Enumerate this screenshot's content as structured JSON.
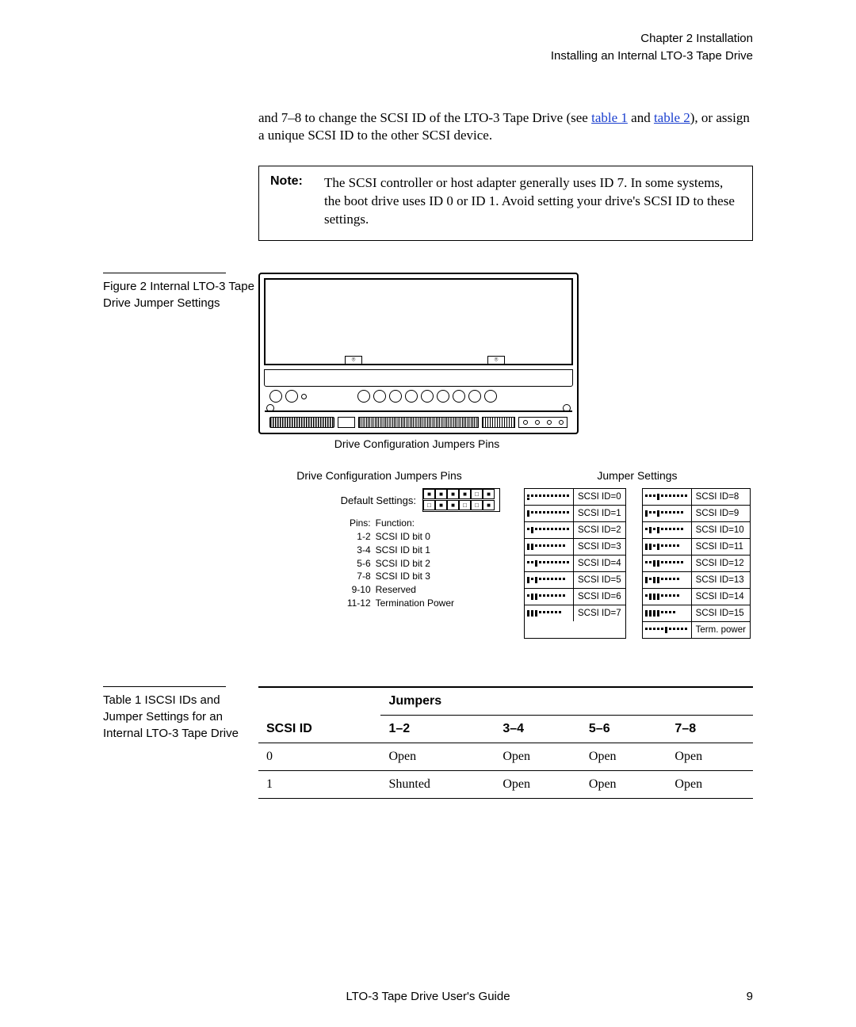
{
  "header": {
    "chapter": "Chapter 2  Installation",
    "section": "Installing an Internal LTO-3 Tape Drive"
  },
  "body": {
    "p1_a": "and 7–8 to change the SCSI ID of the LTO-3 Tape Drive (see ",
    "link1": "table 1",
    "p1_b": " and ",
    "link2": "table 2",
    "p1_c": "), or assign a unique SCSI ID to the other SCSI device."
  },
  "note": {
    "label": "Note:",
    "text": "The SCSI controller or host adapter generally uses ID 7. In some systems, the boot drive uses ID 0 or ID 1. Avoid setting your drive's SCSI ID to these settings."
  },
  "figure": {
    "caption": "Figure 2  Internal LTO-3 Tape Drive Jumper Settings",
    "callout": "Drive Configuration Jumpers Pins",
    "left_title": "Drive Configuration Jumpers Pins",
    "right_title": "Jumper Settings",
    "default_label": "Default Settings:",
    "pins_hdr": "Pins:",
    "func_hdr": "Function:",
    "pin_rows": [
      {
        "p": "1-2",
        "f": "SCSI ID bit 0"
      },
      {
        "p": "3-4",
        "f": "SCSI ID bit 1"
      },
      {
        "p": "5-6",
        "f": "SCSI ID bit 2"
      },
      {
        "p": "7-8",
        "f": "SCSI ID bit 3"
      },
      {
        "p": "9-10",
        "f": "Reserved"
      },
      {
        "p": "11-12",
        "f": "Termination Power"
      }
    ],
    "js_left": [
      "SCSI ID=0",
      "SCSI ID=1",
      "SCSI ID=2",
      "SCSI ID=3",
      "SCSI ID=4",
      "SCSI ID=5",
      "SCSI ID=6",
      "SCSI ID=7"
    ],
    "js_right": [
      "SCSI ID=8",
      "SCSI ID=9",
      "SCSI ID=10",
      "SCSI ID=11",
      "SCSI ID=12",
      "SCSI ID=13",
      "SCSI ID=14",
      "SCSI ID=15",
      "Term. power"
    ]
  },
  "table": {
    "caption": "Table 1   ISCSI IDs and Jumper Settings for an Internal LTO-3 Tape Drive",
    "h_scsi": "SCSI ID",
    "h_jumpers": "Jumpers",
    "cols": [
      "1–2",
      "3–4",
      "5–6",
      "7–8"
    ],
    "rows": [
      {
        "id": "0",
        "c": [
          "Open",
          "Open",
          "Open",
          "Open"
        ]
      },
      {
        "id": "1",
        "c": [
          "Shunted",
          "Open",
          "Open",
          "Open"
        ]
      }
    ]
  },
  "footer": {
    "center": "LTO-3 Tape Drive User's Guide",
    "page": "9"
  }
}
